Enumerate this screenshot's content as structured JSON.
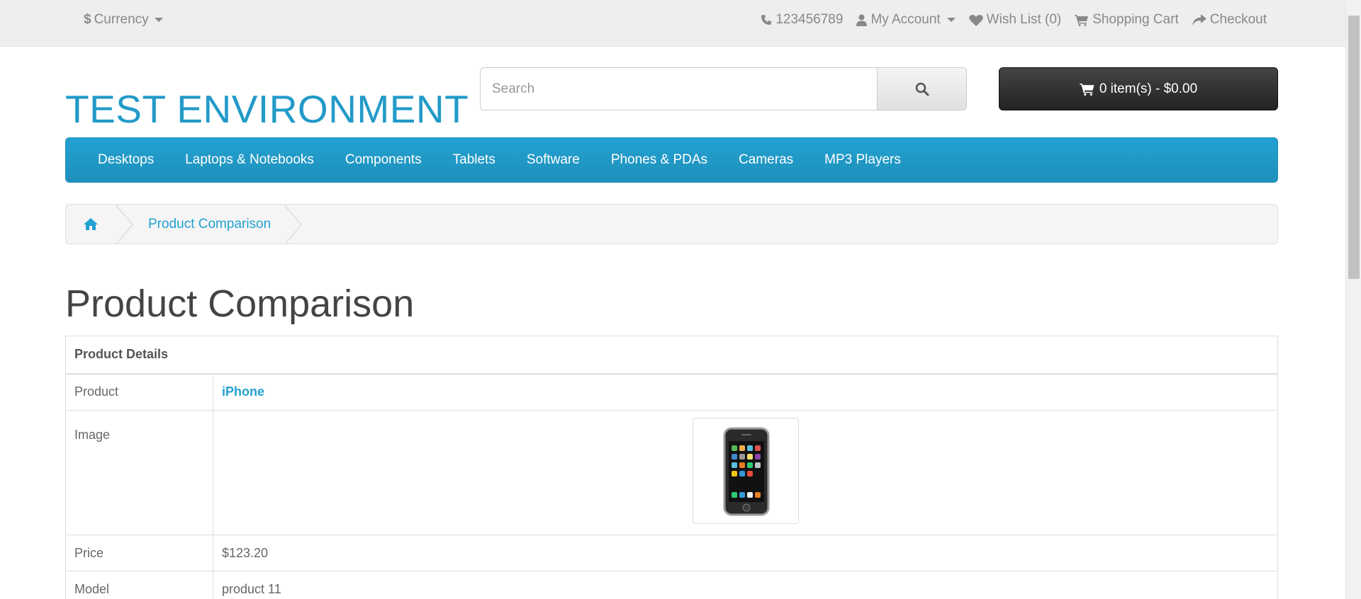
{
  "topbar": {
    "currency_symbol": "$",
    "currency_label": "Currency",
    "phone": "123456789",
    "my_account": "My Account",
    "wish_list": "Wish List (0)",
    "shopping_cart": "Shopping Cart",
    "checkout": "Checkout"
  },
  "header": {
    "logo": "TEST ENVIRONMENT",
    "search_placeholder": "Search",
    "cart_label": "0 item(s) - $0.00"
  },
  "menu": {
    "items": [
      "Desktops",
      "Laptops & Notebooks",
      "Components",
      "Tablets",
      "Software",
      "Phones & PDAs",
      "Cameras",
      "MP3 Players"
    ]
  },
  "breadcrumb": {
    "current": "Product Comparison"
  },
  "page": {
    "title": "Product Comparison"
  },
  "comparison": {
    "header": "Product Details",
    "rows": [
      {
        "label": "Product",
        "value": "iPhone"
      },
      {
        "label": "Image",
        "value": ""
      },
      {
        "label": "Price",
        "value": "$123.20"
      },
      {
        "label": "Model",
        "value": "product 11"
      }
    ]
  },
  "colors": {
    "accent": "#229ac8",
    "menu_bg": "#229ac8",
    "cart_bg": "#303030"
  },
  "icons": [
    "phone-icon",
    "user-icon",
    "heart-icon",
    "shopping-cart-icon",
    "share-icon",
    "search-icon",
    "home-icon"
  ]
}
